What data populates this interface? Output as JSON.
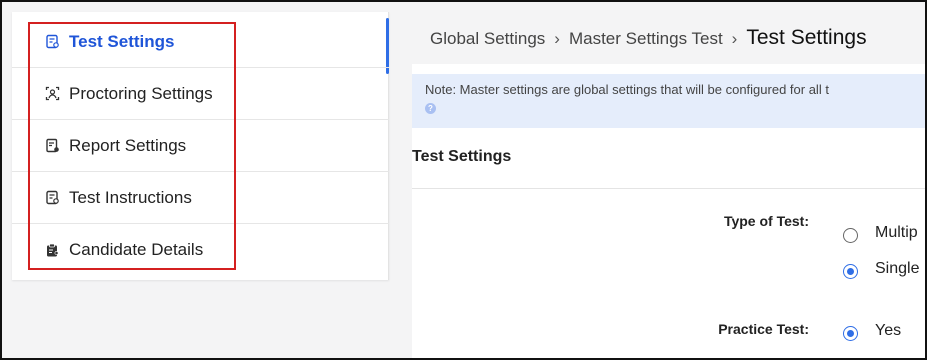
{
  "sidebar": {
    "items": [
      {
        "label": "Test Settings",
        "icon": "test-settings-icon",
        "active": true
      },
      {
        "label": "Proctoring Settings",
        "icon": "proctoring-icon",
        "active": false
      },
      {
        "label": "Report Settings",
        "icon": "report-icon",
        "active": false
      },
      {
        "label": "Test Instructions",
        "icon": "instructions-icon",
        "active": false
      },
      {
        "label": "Candidate Details",
        "icon": "clipboard-user-icon",
        "active": false
      }
    ]
  },
  "breadcrumb": {
    "items": [
      "Global Settings",
      "Master Settings Test"
    ],
    "separator": "›",
    "current": "Test Settings"
  },
  "note": {
    "text": "Note: Master settings are global settings that will be configured for all t",
    "help_icon": "?"
  },
  "section": {
    "title": "Test Settings"
  },
  "fields": {
    "type_of_test": {
      "label": "Type of Test:",
      "options": [
        {
          "label": "Multip",
          "checked": false
        },
        {
          "label": "Single",
          "checked": true
        }
      ]
    },
    "practice_test": {
      "label": "Practice Test:",
      "options": [
        {
          "label": "Yes",
          "checked": true
        }
      ]
    }
  },
  "colors": {
    "accent": "#2f6ee6",
    "active_text": "#1f55d8",
    "note_bg": "#e5edfb",
    "highlight": "#d42020"
  }
}
